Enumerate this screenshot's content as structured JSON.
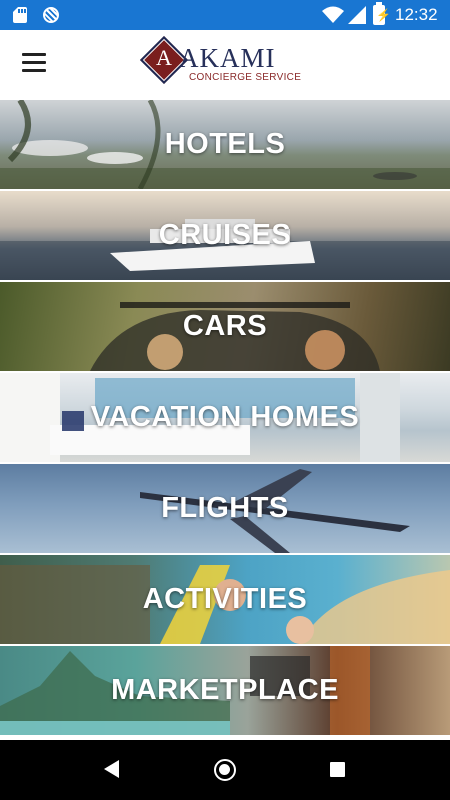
{
  "status_bar": {
    "time": "12:32",
    "icons": [
      "sd-card-icon",
      "sync-icon",
      "wifi-icon",
      "signal-icon",
      "battery-charging-icon"
    ],
    "color": "#1976d2"
  },
  "header": {
    "menu_icon": "hamburger-menu-icon",
    "logo": {
      "letter": "A",
      "name": "AKAMI",
      "tagline": "CONCIERGE SERVICE",
      "primary_color": "#27305a",
      "accent_color": "#7a1e1e"
    }
  },
  "categories": [
    {
      "label": "HOTELS"
    },
    {
      "label": "CRUISES"
    },
    {
      "label": "CARS"
    },
    {
      "label": "VACATION HOMES"
    },
    {
      "label": "FLIGHTS"
    },
    {
      "label": "ACTIVITIES"
    },
    {
      "label": "MARKETPLACE"
    }
  ],
  "nav_bar": {
    "buttons": [
      "back-icon",
      "home-icon",
      "recent-apps-icon"
    ]
  }
}
